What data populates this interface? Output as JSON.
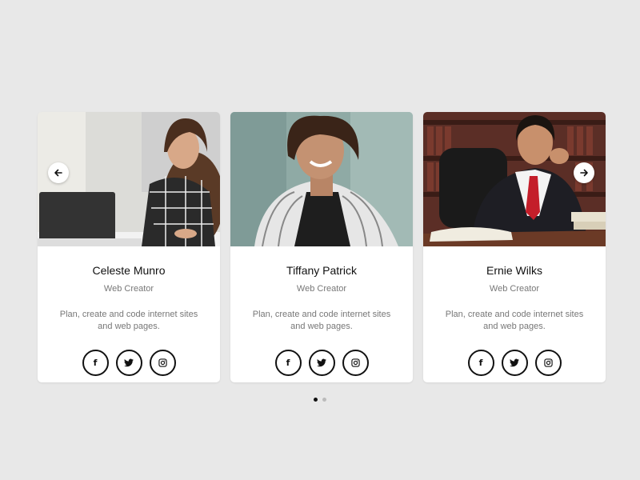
{
  "carousel": {
    "prev_icon": "arrow-left-icon",
    "next_icon": "arrow-right-icon",
    "active_slide": 1,
    "slide_count": 2
  },
  "cards": [
    {
      "name": "Celeste Munro",
      "role": "Web Creator",
      "description": "Plan, create and code internet sites and web pages.",
      "socials": [
        "facebook-icon",
        "twitter-icon",
        "instagram-icon"
      ]
    },
    {
      "name": "Tiffany Patrick",
      "role": "Web Creator",
      "description": "Plan, create and code internet sites and web pages.",
      "socials": [
        "facebook-icon",
        "twitter-icon",
        "instagram-icon"
      ]
    },
    {
      "name": "Ernie Wilks",
      "role": "Web Creator",
      "description": "Plan, create and code internet sites and web pages.",
      "socials": [
        "facebook-icon",
        "twitter-icon",
        "instagram-icon"
      ]
    }
  ],
  "colors": {
    "background": "#e8e8e8",
    "card": "#ffffff",
    "text_primary": "#111111",
    "text_secondary": "#777777",
    "dot_active": "#111111",
    "dot_inactive": "#bbbbbb"
  }
}
